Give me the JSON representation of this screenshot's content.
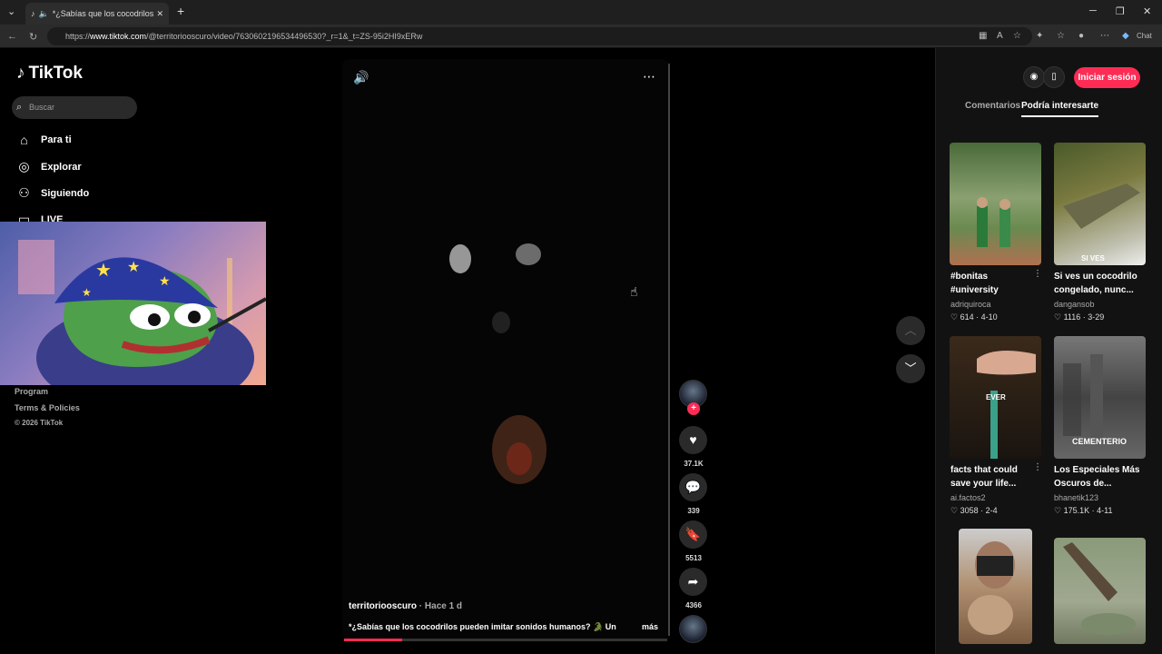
{
  "browser": {
    "tab_title": "*¿Sabías que los cocodrilos p",
    "url_prefix": "https://",
    "url_domain": "www.tiktok.com",
    "url_path": "/@territoriooscuro/video/7630602196534496530?_r=1&_t=ZS-95i2HI9xERw",
    "copilot_label": "Chat"
  },
  "sidebar": {
    "logo": "TikTok",
    "search_placeholder": "Buscar",
    "items": [
      {
        "label": "Para ti",
        "icon": "home-icon"
      },
      {
        "label": "Explorar",
        "icon": "compass-icon"
      },
      {
        "label": "Siguiendo",
        "icon": "following-icon"
      },
      {
        "label": "LIVE",
        "icon": "live-icon"
      }
    ],
    "footer": [
      "Program",
      "Terms & Policies",
      "© 2026 TikTok"
    ]
  },
  "video": {
    "author": "territoriooscuro",
    "time": "· Hace 1 d",
    "caption": "*¿Sabías que los cocodrilos pueden imitar sonidos humanos? 🐊 Un",
    "more": "más",
    "progress": 0.18
  },
  "actions": {
    "likes": "37.1K",
    "comments": "339",
    "saves": "5513",
    "shares": "4366"
  },
  "right_panel": {
    "login": "Iniciar sesión",
    "tabs": [
      "Comentarios",
      "Podría interesarte"
    ],
    "cards": [
      {
        "title": "#bonitas #university",
        "author": "adriquiroca",
        "likes": "614",
        "date": "4-10",
        "overlay": ""
      },
      {
        "title": "Si ves un cocodrilo congelado, nunc...",
        "author": "dangansob",
        "likes": "1116",
        "date": "3-29",
        "overlay": "SI VES"
      },
      {
        "title": "facts that could save your life...",
        "author": "ai.factos2",
        "likes": "3058",
        "date": "2-4",
        "overlay": "EVER"
      },
      {
        "title": "Los Especiales Más Oscuros de...",
        "author": "bhanetik123",
        "likes": "175.1K",
        "date": "4-11",
        "overlay": "CEMENTERIO"
      }
    ]
  },
  "colors": {
    "accent": "#fe2c55",
    "panel": "#121212"
  }
}
